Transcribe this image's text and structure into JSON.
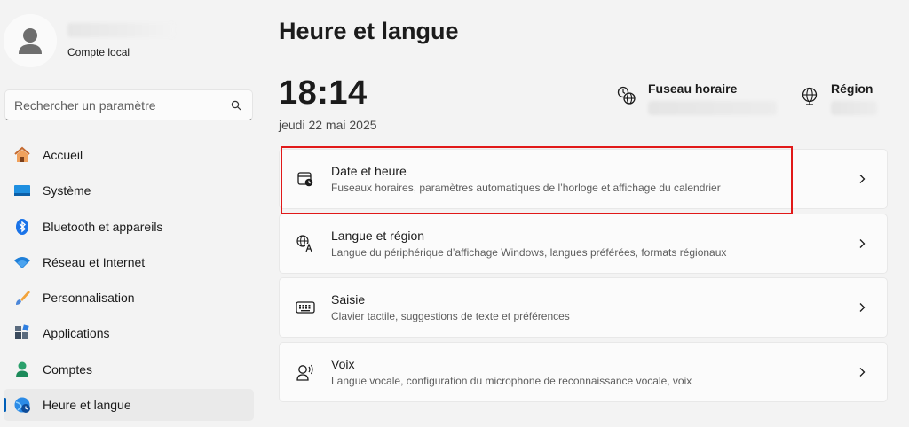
{
  "profile": {
    "account_type": "Compte local"
  },
  "search": {
    "placeholder": "Rechercher un paramètre"
  },
  "sidebar": {
    "items": [
      {
        "label": "Accueil",
        "icon": "home-icon"
      },
      {
        "label": "Système",
        "icon": "monitor-icon"
      },
      {
        "label": "Bluetooth et appareils",
        "icon": "bluetooth-icon"
      },
      {
        "label": "Réseau et Internet",
        "icon": "wifi-icon"
      },
      {
        "label": "Personnalisation",
        "icon": "brush-icon"
      },
      {
        "label": "Applications",
        "icon": "apps-icon"
      },
      {
        "label": "Comptes",
        "icon": "person-icon"
      },
      {
        "label": "Heure et langue",
        "icon": "globe-clock-icon",
        "active": true
      }
    ]
  },
  "main": {
    "title": "Heure et langue",
    "clock": "18:14",
    "date": "jeudi 22 mai 2025",
    "timezone_label": "Fuseau horaire",
    "region_label": "Région",
    "cards": [
      {
        "title": "Date et heure",
        "desc": "Fuseaux horaires, paramètres automatiques de l’horloge et affichage du calendrier",
        "icon": "calendar-clock-icon"
      },
      {
        "title": "Langue et région",
        "desc": "Langue du périphérique d’affichage Windows, langues préférées, formats régionaux",
        "icon": "language-icon"
      },
      {
        "title": "Saisie",
        "desc": "Clavier tactile, suggestions de texte et préférences",
        "icon": "keyboard-icon"
      },
      {
        "title": "Voix",
        "desc": "Langue vocale, configuration du microphone de reconnaissance vocale, voix",
        "icon": "voice-icon"
      }
    ]
  },
  "colors": {
    "accent": "#005fb8",
    "highlight": "#e11919",
    "background": "#f3f3f3"
  }
}
